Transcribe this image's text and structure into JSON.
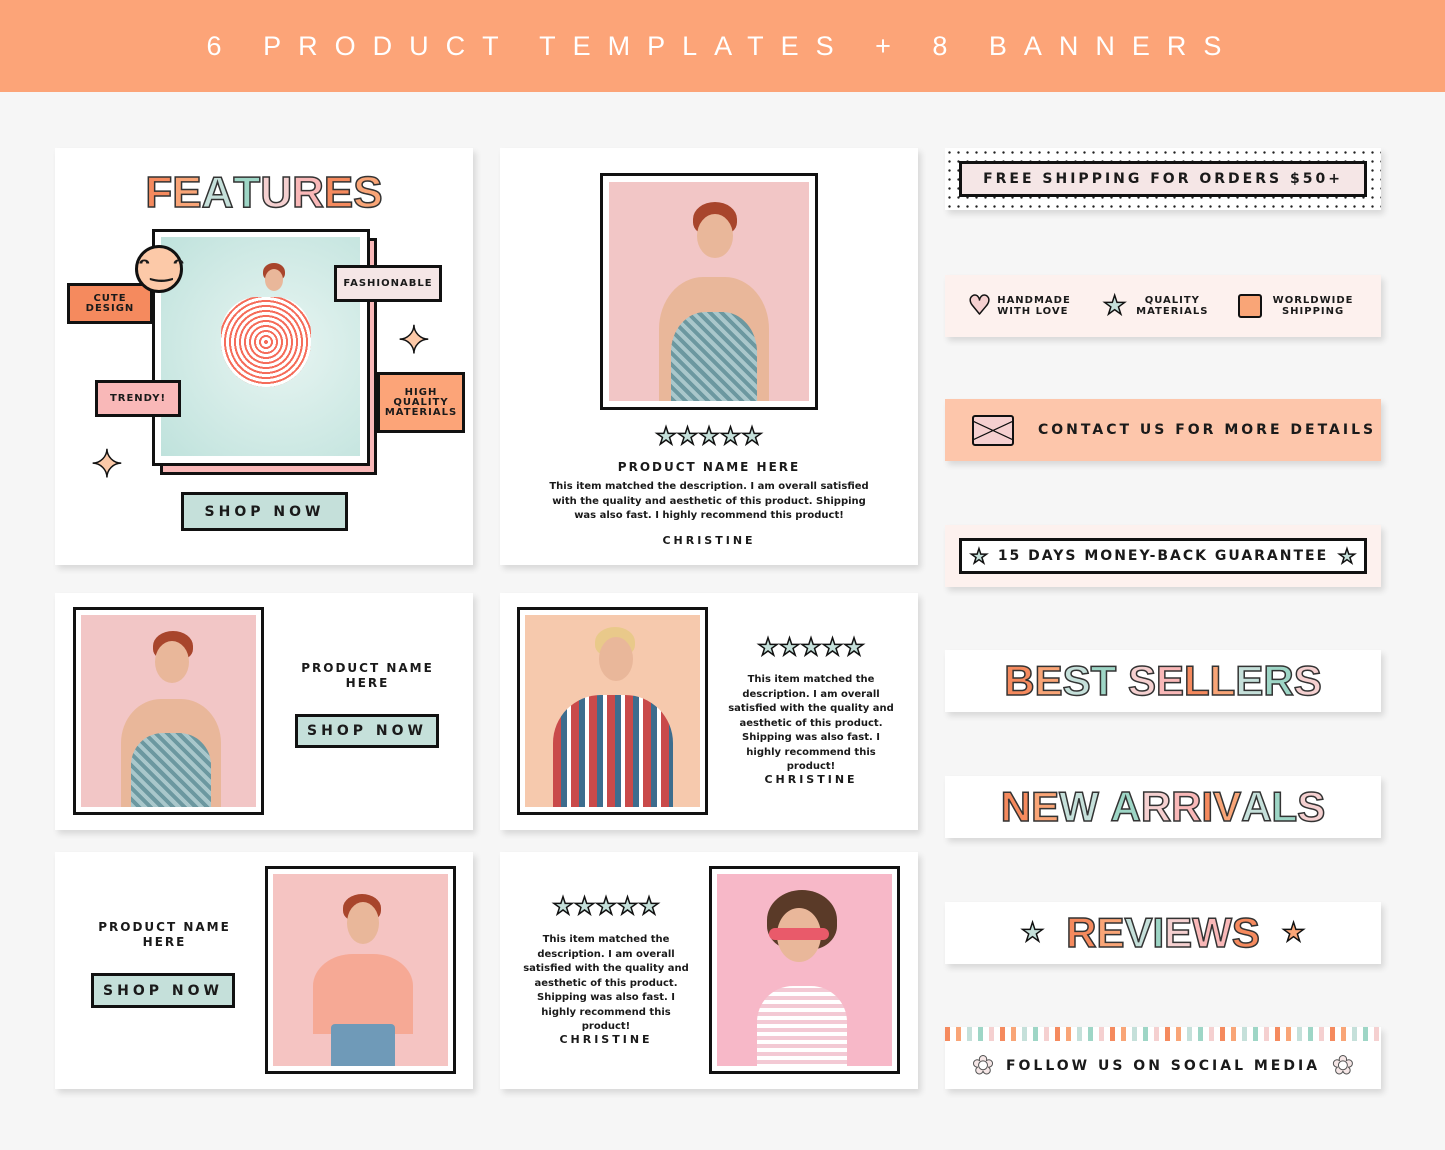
{
  "header": {
    "title": "6 PRODUCT TEMPLATES + 8 BANNERS",
    "color": "#fca478"
  },
  "palette": [
    "#f58a5e",
    "#f9a577",
    "#c5e0da",
    "#9ed6c6",
    "#f5d0d0",
    "#f9b8b8"
  ],
  "features_card": {
    "title": "FEATURES",
    "tags": {
      "cute": "CUTE DESIGN",
      "fashionable": "FASHIONABLE",
      "trendy": "TRENDY!",
      "quality": "HIGH QUALITY MATERIALS"
    },
    "button": "SHOP NOW",
    "icons": [
      "smiley-icon",
      "sparkle-icon"
    ]
  },
  "review_card_1": {
    "rating": 5,
    "stars": "★★★★★",
    "product": "PRODUCT NAME HERE",
    "review": "This item matched the description. I am overall satisfied with the quality and aesthetic of this product. Shipping was also fast. I highly recommend this product!",
    "author": "CHRISTINE"
  },
  "product_card_1": {
    "product": "PRODUCT NAME HERE",
    "button": "SHOP NOW"
  },
  "review_card_2": {
    "rating": 5,
    "stars": "★★★★★",
    "review": "This item matched the description. I am overall satisfied with the quality and aesthetic of this product. Shipping was also fast. I highly recommend this product!",
    "author": "CHRISTINE"
  },
  "product_card_2": {
    "product": "PRODUCT NAME HERE",
    "button": "SHOP NOW"
  },
  "review_card_3": {
    "rating": 5,
    "stars": "★★★★★",
    "review": "This item matched the description. I am overall satisfied with the quality and aesthetic of this product. Shipping was also fast. I highly recommend this product!",
    "author": "CHRISTINE"
  },
  "banners": {
    "shipping": "FREE SHIPPING FOR ORDERS $50+",
    "features": [
      {
        "label": "HANDMADE WITH LOVE",
        "icon": "heart-icon"
      },
      {
        "label": "QUALITY MATERIALS",
        "icon": "star-icon"
      },
      {
        "label": "WORLDWIDE SHIPPING",
        "icon": "box-icon"
      }
    ],
    "contact": "CONTACT US FOR MORE DETAILS",
    "guarantee": "15 DAYS MONEY-BACK GUARANTEE",
    "best": "BEST SELLERS",
    "new": "NEW ARRIVALS",
    "reviews": "REVIEWS",
    "social": "FOLLOW US ON SOCIAL MEDIA"
  }
}
